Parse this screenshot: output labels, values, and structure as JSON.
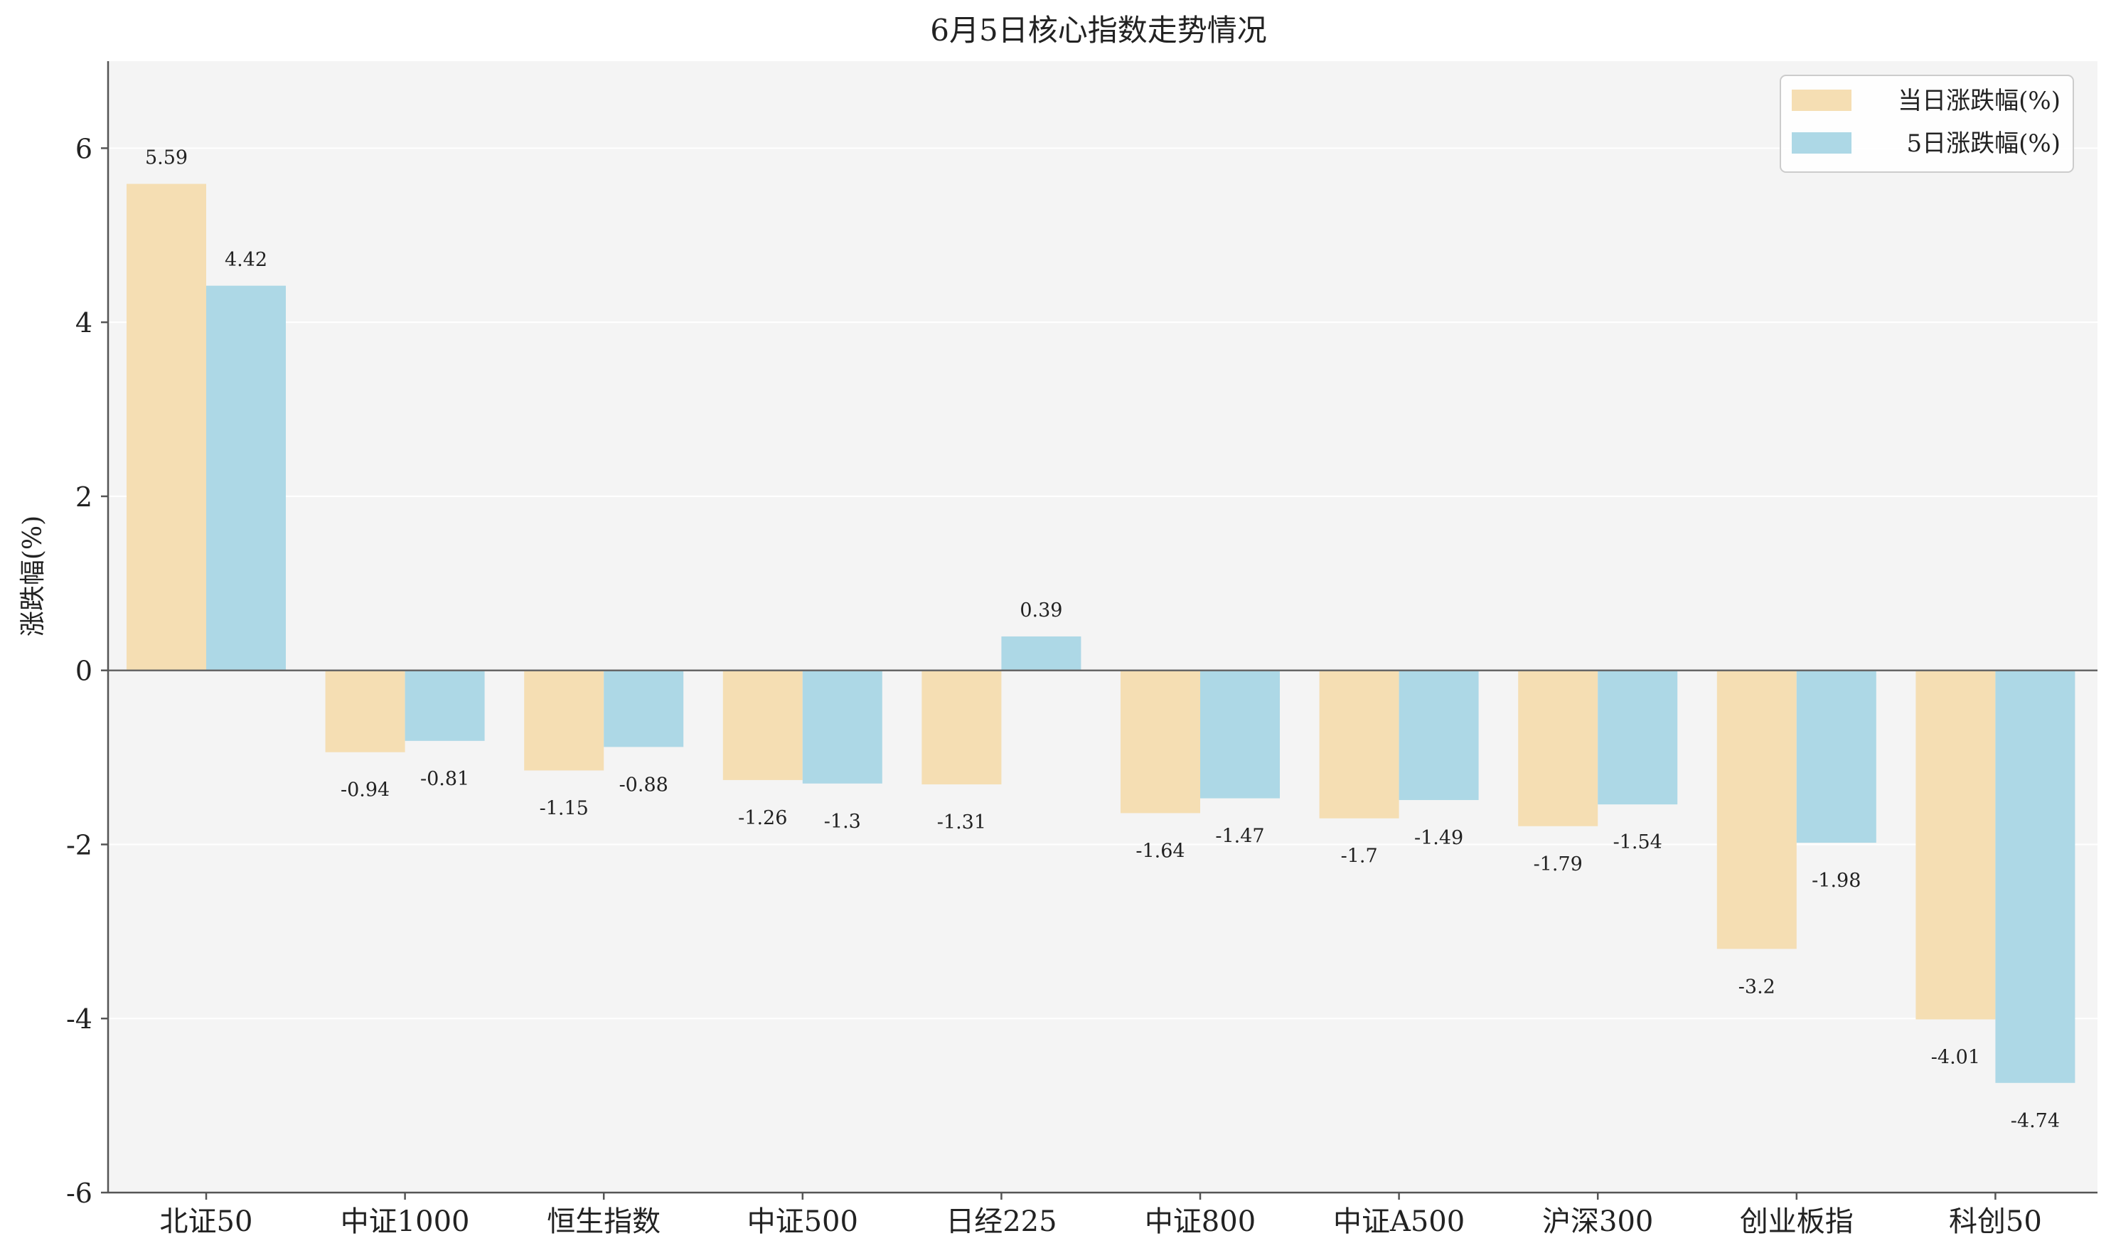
{
  "chart_data": {
    "type": "bar",
    "title": "6月5日核心指数走势情况",
    "xlabel": "",
    "ylabel": "涨跌幅(%)",
    "ylim": [
      -6,
      7
    ],
    "yticks": [
      -6,
      -4,
      -2,
      0,
      2,
      4,
      6
    ],
    "ytick_labels": [
      "-6",
      "-4",
      "-2",
      "0",
      "2",
      "4",
      "6"
    ],
    "grid": true,
    "legend_position": "top-right",
    "categories": [
      "北证50",
      "中证1000",
      "恒生指数",
      "中证500",
      "日经225",
      "中证800",
      "中证A500",
      "沪深300",
      "创业板指",
      "科创50"
    ],
    "series": [
      {
        "name": "当日涨跌幅(%)",
        "color": "#F5DEB3",
        "values": [
          5.59,
          -0.94,
          -1.15,
          -1.26,
          -1.31,
          -1.64,
          -1.7,
          -1.79,
          -3.2,
          -4.01
        ],
        "labels": [
          "5.59",
          "-0.94",
          "-1.15",
          "-1.26",
          "-1.31",
          "-1.64",
          "-1.7",
          "-1.79",
          "-3.2",
          "-4.01"
        ]
      },
      {
        "name": "5日涨跌幅(%)",
        "color": "#ADD8E6",
        "values": [
          4.42,
          -0.81,
          -0.88,
          -1.3,
          0.39,
          -1.47,
          -1.49,
          -1.54,
          -1.98,
          -4.74
        ],
        "labels": [
          "4.42",
          "-0.81",
          "-0.88",
          "-1.3",
          "0.39",
          "-1.47",
          "-1.49",
          "-1.54",
          "-1.98",
          "-4.74"
        ]
      }
    ],
    "colors": {
      "plot_background": "#F4F4F4",
      "grid": "#FFFFFF",
      "axis": "#555555",
      "zero_line": "#666666"
    }
  }
}
